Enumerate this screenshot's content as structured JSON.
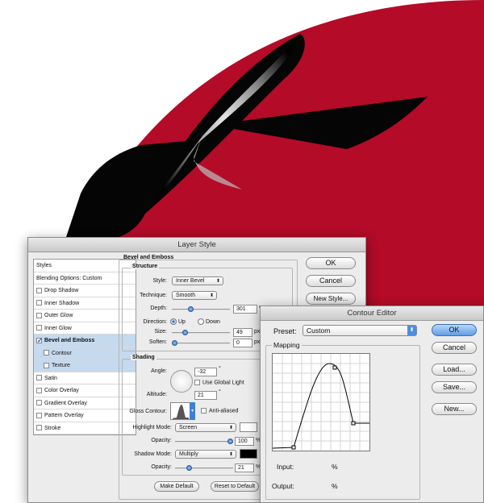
{
  "layer_style": {
    "title": "Layer Style",
    "styles_list": {
      "header": "Styles",
      "blending_options": "Blending Options: Custom",
      "items": [
        {
          "label": "Drop Shadow",
          "checked": false,
          "selected": false,
          "sub": false
        },
        {
          "label": "Inner Shadow",
          "checked": false,
          "selected": false,
          "sub": false
        },
        {
          "label": "Outer Glow",
          "checked": false,
          "selected": false,
          "sub": false
        },
        {
          "label": "Inner Glow",
          "checked": false,
          "selected": false,
          "sub": false
        },
        {
          "label": "Bevel and Emboss",
          "checked": true,
          "selected": true,
          "sub": false
        },
        {
          "label": "Contour",
          "checked": false,
          "selected": true,
          "sub": true
        },
        {
          "label": "Texture",
          "checked": false,
          "selected": true,
          "sub": true
        },
        {
          "label": "Satin",
          "checked": false,
          "selected": false,
          "sub": false
        },
        {
          "label": "Color Overlay",
          "checked": false,
          "selected": false,
          "sub": false
        },
        {
          "label": "Gradient Overlay",
          "checked": false,
          "selected": false,
          "sub": false
        },
        {
          "label": "Pattern Overlay",
          "checked": false,
          "selected": false,
          "sub": false
        },
        {
          "label": "Stroke",
          "checked": false,
          "selected": false,
          "sub": false
        }
      ]
    },
    "bevel": {
      "section_title": "Bevel and Emboss",
      "structure_title": "Structure",
      "style_label": "Style:",
      "style_value": "Inner Bevel",
      "technique_label": "Technique:",
      "technique_value": "Smooth",
      "depth_label": "Depth:",
      "depth_value": "301",
      "depth_unit": "%",
      "depth_level": 0.3,
      "direction_label": "Direction:",
      "direction_up": "Up",
      "direction_down": "Down",
      "size_label": "Size:",
      "size_value": "49",
      "size_unit": "px",
      "size_level": 0.2,
      "soften_label": "Soften:",
      "soften_value": "0",
      "soften_unit": "px",
      "soften_level": 0.0
    },
    "shading": {
      "title": "Shading",
      "angle_label": "Angle:",
      "angle_value": "-32",
      "angle_unit": "°",
      "global_light_label": "Use Global Light",
      "altitude_label": "Altitude:",
      "altitude_value": "21",
      "altitude_unit": "°",
      "gloss_label": "Gloss Contour:",
      "anti_aliased_label": "Anti-aliased",
      "highlight_mode_label": "Highlight Mode:",
      "highlight_mode_value": "Screen",
      "highlight_color": "#ffffff",
      "highlight_opacity_label": "Opacity:",
      "highlight_opacity_value": "100",
      "highlight_opacity_level": 1.0,
      "shadow_mode_label": "Shadow Mode:",
      "shadow_mode_value": "Multiply",
      "shadow_color": "#000000",
      "shadow_opacity_label": "Opacity:",
      "shadow_opacity_value": "21",
      "shadow_opacity_level": 0.21,
      "percent": "%"
    },
    "make_default": "Make Default",
    "reset_default": "Reset to Default",
    "buttons": {
      "ok": "OK",
      "cancel": "Cancel",
      "new_style": "New Style..."
    }
  },
  "contour_editor": {
    "title": "Contour Editor",
    "preset_label": "Preset:",
    "preset_value": "Custom",
    "mapping_label": "Mapping",
    "input_label": "Input:",
    "input_unit": "%",
    "output_label": "Output:",
    "output_unit": "%",
    "buttons": {
      "ok": "OK",
      "cancel": "Cancel",
      "load": "Load...",
      "save": "Save...",
      "new": "New..."
    }
  },
  "colors": {
    "background_red": "#b30b28",
    "accent_blue": "#5f9ee6"
  }
}
